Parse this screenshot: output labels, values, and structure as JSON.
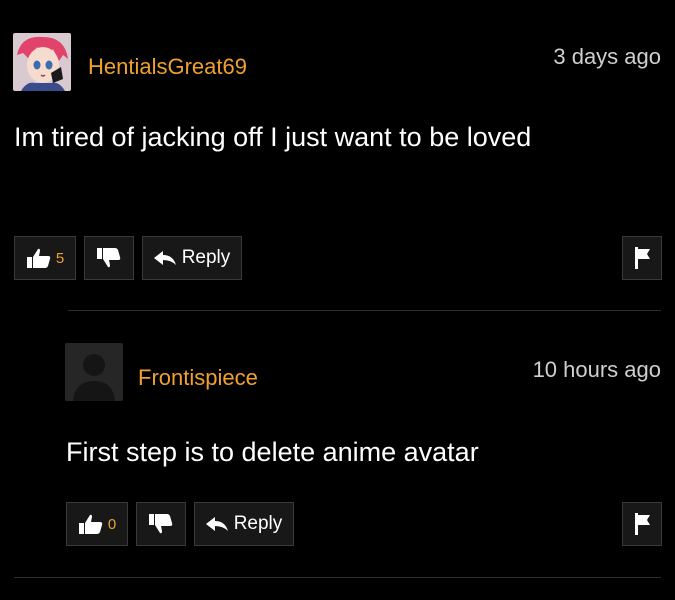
{
  "comments": [
    {
      "username": "HentialsGreat69",
      "time": "3 days ago",
      "text": "Im tired of jacking off I just want to be loved",
      "likes": "5",
      "reply_label": "Reply",
      "avatar": "anime-avatar"
    },
    {
      "username": "Frontispiece",
      "time": "10 hours ago",
      "text": "First step is to delete anime avatar",
      "likes": "0",
      "reply_label": "Reply",
      "avatar": "default-avatar"
    }
  ],
  "colors": {
    "username": "#f0a030",
    "background": "#000000",
    "button_bg": "#181818"
  }
}
